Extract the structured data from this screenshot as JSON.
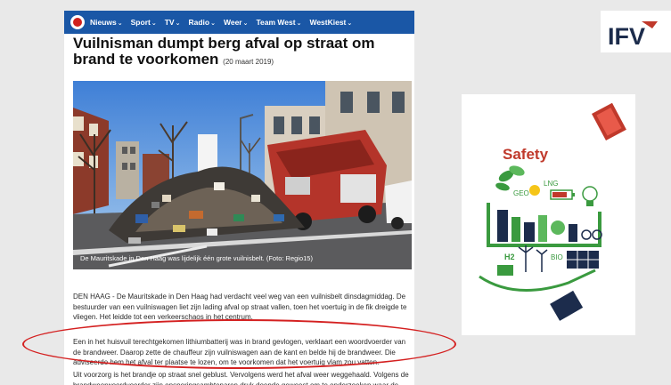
{
  "nav": {
    "items": [
      {
        "label": "Nieuws"
      },
      {
        "label": "Sport"
      },
      {
        "label": "TV"
      },
      {
        "label": "Radio"
      },
      {
        "label": "Weer"
      },
      {
        "label": "Team West"
      },
      {
        "label": "WestKiest"
      }
    ],
    "chevron": "⌄"
  },
  "article": {
    "title": "Vuilnisman dumpt berg afval op straat om brand te voorkomen",
    "date": "(20 maart 2019)",
    "image_caption": "De Mauritskade in Den Haag was lijdelijk één grote vuilnisbelt. (Foto: Regio15)",
    "paragraphs": [
      "DEN HAAG - De Mauritskade in Den Haag had verdacht veel weg van een vuilnisbelt dinsdagmiddag. De bestuurder van een vuilniswagen liet zijn lading afval op straat vallen, toen het voertuig in de fik dreigde te vliegen. Het leidde tot een verkeerschaos in het centrum.",
      "Een in het huisvuil terechtgekomen lithiumbatterij was in brand gevlogen, verklaart een woordvoerder van de brandweer. Daarop zette de chauffeur zijn vuilniswagen aan de kant en belde hij de brandweer. Die adviseerde hem het afval ter plaatse te lozen, om te voorkomen dat het voertuig vlam zou vatten.",
      "Uit voorzorg is het brandje op straat snel geblust. Vervolgens werd het afval weer weggehaald. Volgens de brandweerwoordvoerder zijn opsporingsambtenaren druk doende geweest om te onderzoeken waar de bewuste lithiumbatterij vandaan komt."
    ]
  },
  "sidebar": {
    "logo_text": "IFV",
    "safety_title": "Safety",
    "safety_labels": [
      "GEO",
      "LNG",
      "H2",
      "BIO"
    ]
  },
  "colors": {
    "nav_blue": "#1a57a6",
    "highlight_red": "#d42020",
    "safety_red": "#c0392b",
    "safety_green": "#3a9a3f",
    "ifv_navy": "#1c2c4c"
  },
  "icons": [
    "broadcaster-logo-icon",
    "chevron-down-icon",
    "ifv-logo",
    "safety-illustration"
  ]
}
